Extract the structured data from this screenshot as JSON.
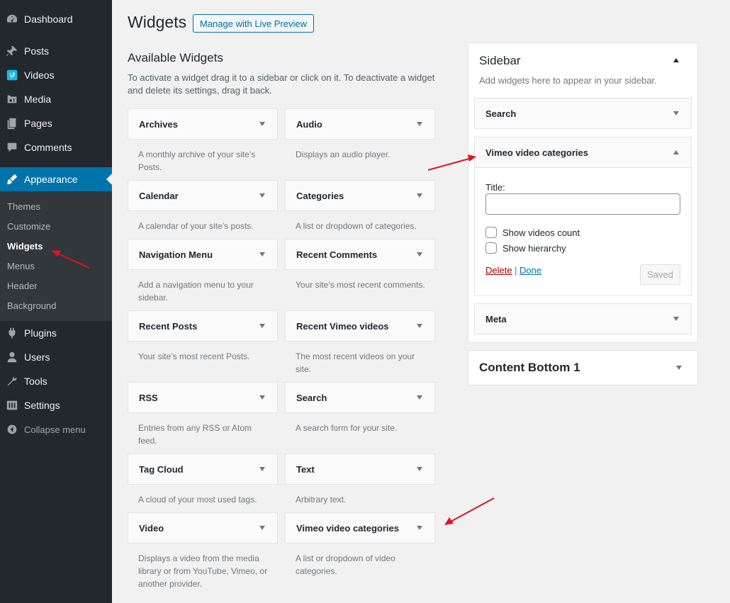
{
  "menu": {
    "dashboard": "Dashboard",
    "posts": "Posts",
    "videos": "Videos",
    "media": "Media",
    "pages": "Pages",
    "comments": "Comments",
    "appearance": "Appearance",
    "plugins": "Plugins",
    "users": "Users",
    "tools": "Tools",
    "settings": "Settings",
    "collapse": "Collapse menu",
    "submenu": {
      "themes": "Themes",
      "customize": "Customize",
      "widgets": "Widgets",
      "menus": "Menus",
      "header": "Header",
      "background": "Background"
    }
  },
  "header": {
    "title": "Widgets",
    "live_preview": "Manage with Live Preview"
  },
  "available": {
    "title": "Available Widgets",
    "description": "To activate a widget drag it to a sidebar or click on it. To deactivate a widget and delete its settings, drag it back.",
    "widgets": [
      {
        "name": "Archives",
        "desc": "A monthly archive of your site’s Posts."
      },
      {
        "name": "Audio",
        "desc": "Displays an audio player."
      },
      {
        "name": "Calendar",
        "desc": "A calendar of your site’s posts."
      },
      {
        "name": "Categories",
        "desc": "A list or dropdown of categories."
      },
      {
        "name": "Navigation Menu",
        "desc": "Add a navigation menu to your sidebar."
      },
      {
        "name": "Recent Comments",
        "desc": "Your site’s most recent comments."
      },
      {
        "name": "Recent Posts",
        "desc": "Your site’s most recent Posts."
      },
      {
        "name": "Recent Vimeo videos",
        "desc": "The most recent videos on your site."
      },
      {
        "name": "RSS",
        "desc": "Entries from any RSS or Atom feed."
      },
      {
        "name": "Search",
        "desc": "A search form for your site."
      },
      {
        "name": "Tag Cloud",
        "desc": "A cloud of your most used tags."
      },
      {
        "name": "Text",
        "desc": "Arbitrary text."
      },
      {
        "name": "Video",
        "desc": "Displays a video from the media library or from YouTube, Vimeo, or another provider."
      },
      {
        "name": "Vimeo video categories",
        "desc": "A list or dropdown of video categories."
      }
    ]
  },
  "sidebar": {
    "title": "Sidebar",
    "description": "Add widgets here to appear in your sidebar.",
    "widgets": {
      "search": "Search",
      "vimeo": "Vimeo video categories",
      "meta": "Meta"
    },
    "vimeo_form": {
      "title_label": "Title:",
      "title_value": "",
      "show_count": "Show videos count",
      "show_hierarchy": "Show hierarchy",
      "delete": "Delete",
      "separator": "|",
      "done": "Done",
      "saved": "Saved"
    }
  },
  "content_bottom": {
    "title": "Content Bottom 1"
  },
  "colors": {
    "menu_bg": "#23282d",
    "submenu_bg": "#32373c",
    "accent": "#0073aa",
    "annotation_arrow": "#e0141e",
    "delete": "#aa0000"
  }
}
